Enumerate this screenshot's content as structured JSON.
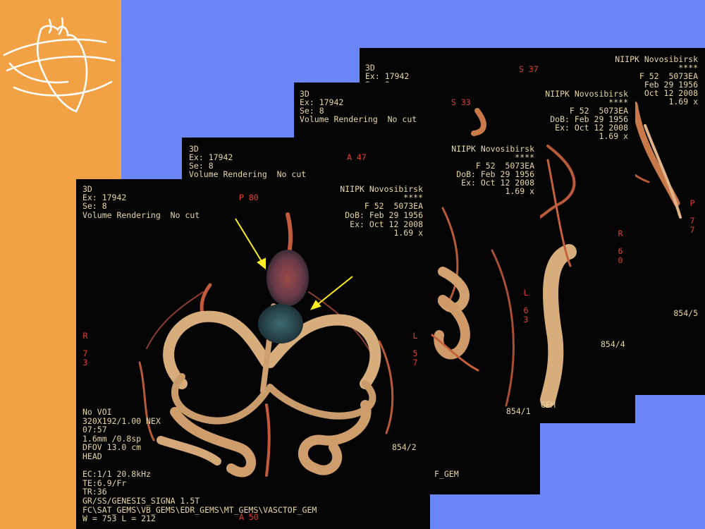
{
  "colors": {
    "background": "#6b86f7",
    "sidebar": "#f2a244",
    "panel": "#040404",
    "overlay_text": "#e8d6a4",
    "orientation_text": "#e0402e",
    "arrow": "#ffee22"
  },
  "logo": {
    "icon": "heart-logo-icon"
  },
  "panels": [
    {
      "id": "854/5",
      "view": "3D",
      "exam": "Ex: 17942",
      "series": "Se: 8",
      "orient_top": "S 37",
      "institution": "NIIPK Novosibirsk",
      "stars": "****",
      "patient": "F 52  5073EA",
      "dob": "Feb 29 1956",
      "date": "Oct 12 2008",
      "zoom": "1.69 x",
      "orient_right": "P\n\n7\n7",
      "orient_left": "R\n\n6\n0",
      "image_number": "854/5"
    },
    {
      "id": "854/4",
      "view": "3D",
      "exam": "Ex: 17942",
      "series": "Se: 8",
      "mode": "Volume Rendering  No cut",
      "orient_top": "S 33",
      "institution": "NIIPK Novosibirsk",
      "stars": "****",
      "patient": "F 52  5073EA",
      "dob": "DoB: Feb 29 1956",
      "date": "Ex: Oct 12 2008",
      "zoom": "1.69 x",
      "orient_right": "L\n\n6\n3",
      "image_number": "854/4",
      "bottom_text": "GEM"
    },
    {
      "id": "854/1",
      "view": "3D",
      "exam": "Ex: 17942",
      "series": "Se: 8",
      "mode": "Volume Rendering  No cut",
      "orient_top": "A 47",
      "institution": "NIIPK Novosibirsk",
      "stars": "****",
      "patient": "F 52  5073EA",
      "dob": "DoB: Feb 29 1956",
      "date": "Ex: Oct 12 2008",
      "zoom": "1.69 x",
      "image_number": "854/1",
      "bottom_text": "F_GEM"
    },
    {
      "id": "854/2",
      "view": "3D",
      "exam": "Ex: 17942",
      "series": "Se: 8",
      "mode": "Volume Rendering  No cut",
      "orient_top": "P 80",
      "institution": "NIIPK Novosibirsk",
      "stars": "****",
      "patient": "F 52  5073EA",
      "dob": "DoB: Feb 29 1956",
      "date": "Ex: Oct 12 2008",
      "zoom": "1.69 x",
      "orient_left": "R\n\n7\n3",
      "orient_right": "L\n\n5\n7",
      "orient_bottom": "A 50",
      "image_number": "854/2",
      "params": "No VOI\n320X192/1.00 NEX\n07:57\n1.6mm /0.8sp\nDFOV 13.0 cm\nHEAD\n\nEC:1/1 20.8kHz\nTE:6.9/Fr\nTR:36\nGR/SS/GENESIS_SIGNA 1.5T\nFC\\SAT_GEMS\\VB_GEMS\\EDR_GEMS\\MT_GEMS\\VASCTOF_GEM\nW = 753 L = 212"
    }
  ]
}
